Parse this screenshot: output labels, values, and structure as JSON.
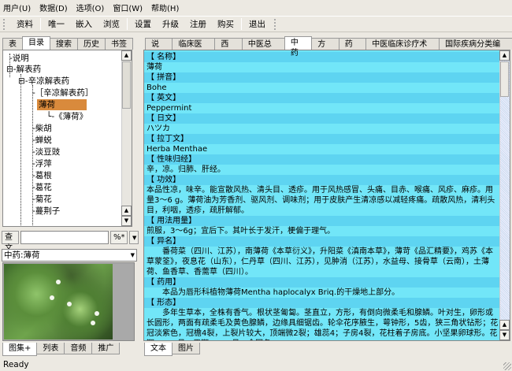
{
  "menu": [
    "用户(U)",
    "数据(D)",
    "选项(O)",
    "窗口(W)",
    "帮助(H)"
  ],
  "toolbar": [
    "资料",
    "唯一",
    "嵌入",
    "浏览",
    "设置",
    "升级",
    "注册",
    "购买",
    "退出"
  ],
  "left_tabs": [
    "表",
    "目录",
    "搜索",
    "历史",
    "书签"
  ],
  "tree": [
    "说明",
    "解表药",
    "辛凉解表药",
    "［辛凉解表药］",
    "薄荷",
    "《薄荷》",
    "柴胡",
    "蝉蜕",
    "淡豆豉",
    "浮萍",
    "葛根",
    "葛花",
    "菊花",
    "蔓荆子"
  ],
  "search": {
    "button": "查文",
    "value": "",
    "mode": "%*"
  },
  "combo": "中药:薄荷",
  "bottom_left_tabs": [
    "图集+",
    "列表",
    "音频",
    "推广"
  ],
  "status": "Ready",
  "right_tabs": [
    "说明",
    "临床医学",
    "西药",
    "中医总论",
    "中药",
    "方剂",
    "药膳",
    "中医临床诊疗术语",
    "国际疾病分类编码"
  ],
  "content": [
    {
      "h": "【 名称】"
    },
    {
      "t": "薄荷"
    },
    {
      "h": "【 拼音】"
    },
    {
      "t": "Bohe"
    },
    {
      "h": "【 英文】"
    },
    {
      "t": "Peppermint"
    },
    {
      "h": "【 日文】"
    },
    {
      "t": "ハツカ"
    },
    {
      "h": "【 拉丁文】"
    },
    {
      "t": "Herba Menthae"
    },
    {
      "h": "【 性味归经】"
    },
    {
      "t": "辛，凉。归肺、肝经。"
    },
    {
      "h": "【 功效】"
    },
    {
      "t": "本品性凉，味辛。能宣散风热、清头目、透疹。用于风热感冒、头痛、目赤、喉痛、风疹、麻疹。用量3～6 g。薄荷油为芳香剂、驱风剂、调味剂；用于皮肤产生清凉感以减轻疼痛。疏散风热，清利头目，利咽，透疹，疏肝解郁。"
    },
    {
      "h": "【 用法用量】"
    },
    {
      "t": "煎服，3～6g；宜后下。其叶长于发汗，梗偏于理气。"
    },
    {
      "h": "【 异名】"
    },
    {
      "t": "　　番荷菜（四川、江苏），南薄荷《本草衍义》，升阳菜《滇南本草》，薄苛《品汇精要》，鸡苏《本草蒙筌》，夜息花（山东），仁丹草（四川、江苏），见肿消（江苏），水益母、接骨草（云南），土薄荷、鱼香草、香薷草（四川）。"
    },
    {
      "h": "【 药用】"
    },
    {
      "t": "　　本品为唇形科植物薄荷Mentha haplocalyx Briq.的干燥地上部分。"
    },
    {
      "h": "【 形态】"
    },
    {
      "t": "　　多年生草本，全株有香气。根状茎匍匐。茎直立，方形，有倒向微柔毛和腺鳞。叶对生，卵形或长圆形，两面有疏柔毛及黄色腺鳞，边缘具细锯齿。轮伞花序腋生，萼钟形，5齿，狭三角状钻形；花冠淡紫色，冠檐4裂，上裂片较大，顶端微2裂；雄蕊4；子房4裂，花柱着子房底。小坚果卵球形。花期8～10月，果期9～11月。全国各"
    }
  ],
  "content_tabs": [
    "文本",
    "图片"
  ]
}
